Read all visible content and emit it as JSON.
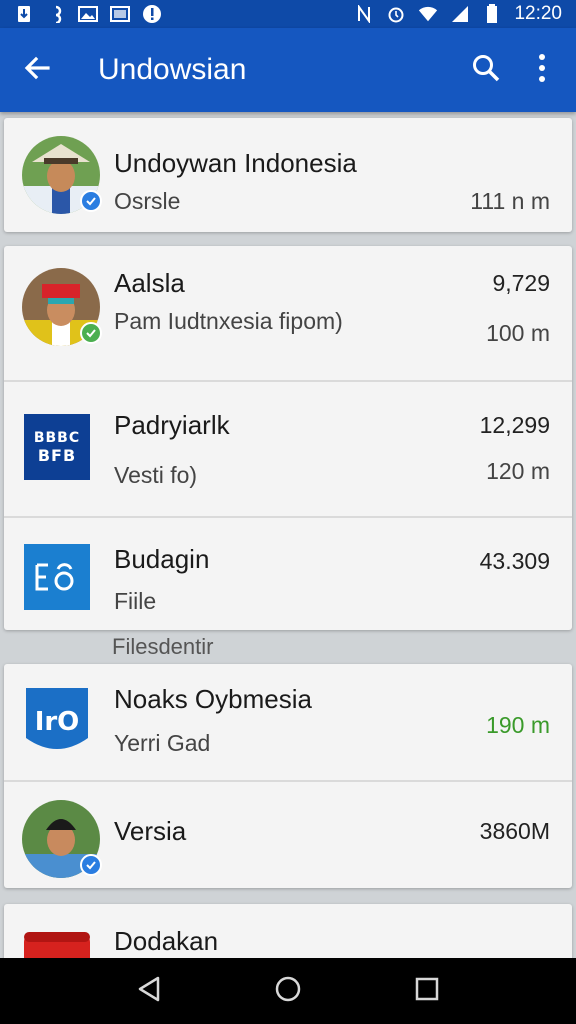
{
  "statusbar": {
    "time": "12:20"
  },
  "appbar": {
    "title": "Undowsian"
  },
  "section_label": "Filesdentir",
  "items": [
    {
      "title": "Undoywan Indonesia",
      "subtitle": "Osrsle",
      "right_top": "",
      "right_bottom": "111 n m"
    },
    {
      "title": "Aalsla",
      "subtitle": "Pam Iudtnxesia  fipom)",
      "right_top": "9,729",
      "right_bottom": "100 m"
    },
    {
      "title": "Padryiarlk",
      "subtitle": "Vesti fo)",
      "right_top": "12,299",
      "right_bottom": "120 m",
      "logo_text_1": "BBBC",
      "logo_text_2": "BFB"
    },
    {
      "title": "Budagin",
      "subtitle": "Fiile",
      "right_top": "43.309",
      "right_bottom": ""
    },
    {
      "title": "Noaks Oybmesia",
      "subtitle": "Yerri Gad",
      "right_top": "",
      "right_bottom": "190 m",
      "logo_text": "IrO"
    },
    {
      "title": "Versia",
      "subtitle": "",
      "right_top": "3860M",
      "right_bottom": ""
    },
    {
      "title": "Dodakan",
      "subtitle": "",
      "right_top": "",
      "right_bottom": ""
    }
  ],
  "colors": {
    "primary": "#1557c0",
    "status_bar": "#0e4aa8",
    "verified": "#2a7de1",
    "green_value": "#3a9a2a"
  }
}
